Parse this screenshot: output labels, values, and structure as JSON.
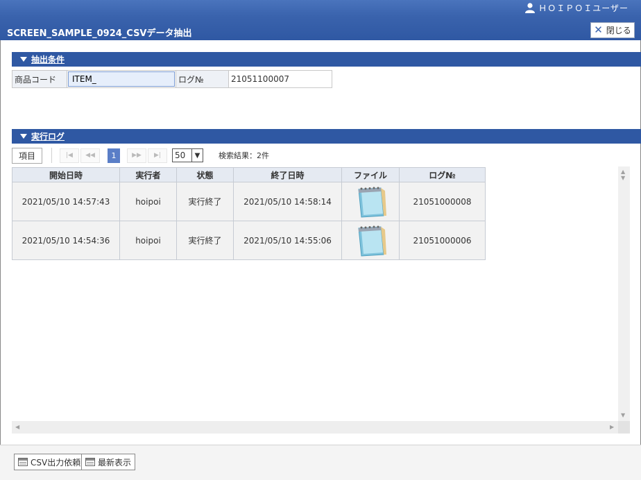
{
  "header": {
    "user_name": "ＨＯＩＰＯＩユーザー",
    "screen_title": "SCREEN_SAMPLE_0924_CSVデータ抽出",
    "close_label": "閉じる"
  },
  "condition_section": {
    "title": "抽出条件",
    "product_code_label": "商品コード",
    "product_code_value": "ITEM_",
    "log_no_label": "ログ№",
    "log_no_value": "21051100007"
  },
  "log_section": {
    "title": "実行ログ",
    "columns_button": "項目",
    "current_page": "1",
    "page_size": "50",
    "result_text": "検索結果：2件",
    "columns": [
      "開始日時",
      "実行者",
      "状態",
      "終了日時",
      "ファイル",
      "ログ№"
    ],
    "rows": [
      {
        "start": "2021/05/10 14:57:43",
        "user": "hoipoi",
        "status": "実行終了",
        "end": "2021/05/10 14:58:14",
        "file": "notepad-icon",
        "log_no": "21051000008"
      },
      {
        "start": "2021/05/10 14:54:36",
        "user": "hoipoi",
        "status": "実行終了",
        "end": "2021/05/10 14:55:06",
        "file": "notepad-icon",
        "log_no": "21051000006"
      }
    ]
  },
  "footer": {
    "csv_button": "CSV出力依頼",
    "refresh_button": "最新表示"
  },
  "colors": {
    "header_blue": "#2f58a3",
    "page_active": "#5a7ec7"
  }
}
